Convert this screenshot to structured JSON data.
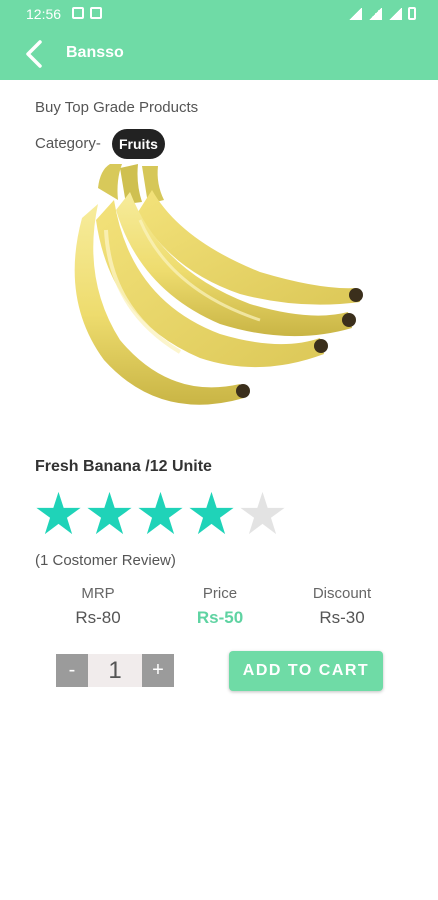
{
  "status_bar": {
    "time": "12:56"
  },
  "app_bar": {
    "title": "Bansso"
  },
  "page": {
    "subtitle": "Buy Top Grade Products",
    "category_label": "Category-",
    "category_value": "Fruits"
  },
  "product": {
    "name": "Fresh Banana /12 Unite",
    "rating": 4,
    "rating_max": 5,
    "review_text": "(1 Costomer Review)",
    "mrp_label": "MRP",
    "mrp_value": "Rs-80",
    "price_label": "Price",
    "price_value": "Rs-50",
    "discount_label": "Discount",
    "discount_value": "Rs-30"
  },
  "quantity": {
    "minus": "-",
    "value": "1",
    "plus": "+"
  },
  "actions": {
    "add_to_cart": "ADD TO CART"
  },
  "colors": {
    "accent": "#6fdba6",
    "star_filled": "#1fd3b8",
    "star_empty": "#e3e3e3",
    "price_highlight": "#5fd3a2"
  }
}
